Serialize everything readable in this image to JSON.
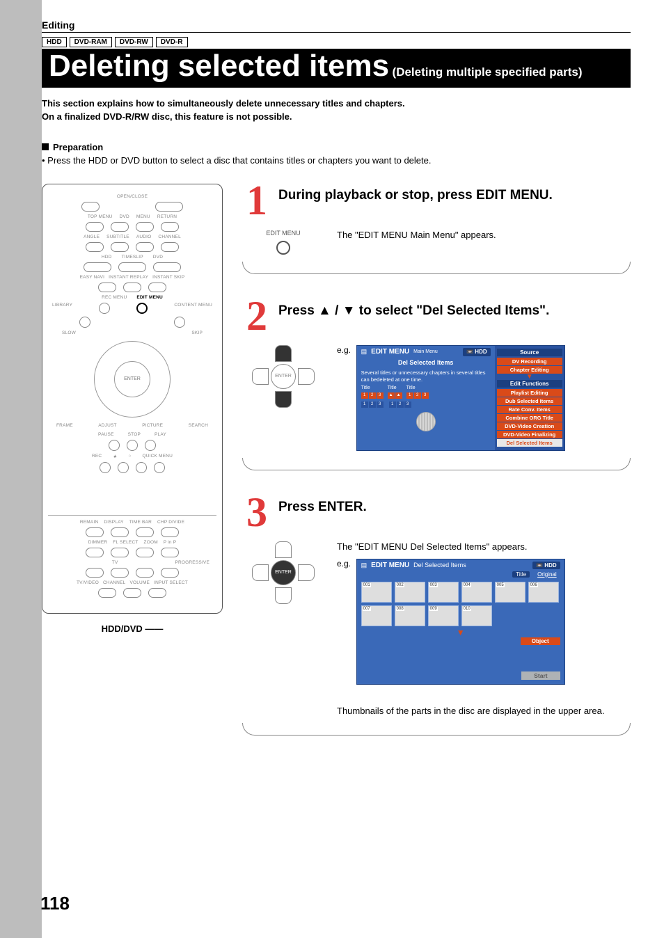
{
  "section": "Editing",
  "badges": [
    "HDD",
    "DVD-RAM",
    "DVD-RW",
    "DVD-R"
  ],
  "title_main": "Deleting selected items",
  "title_sub": "(Deleting multiple specified parts)",
  "intro_line1": "This section explains how to simultaneously delete unnecessary titles and chapters.",
  "intro_line2": "On a finalized DVD-R/RW disc, this feature is not possible.",
  "prep_head": "Preparation",
  "prep_body": "• Press the HDD or DVD button to select a disc that contains titles or chapters you want to delete.",
  "remote": {
    "open_close": "OPEN/CLOSE",
    "dvd": "DVD",
    "top_menu": "TOP MENU",
    "menu": "MENU",
    "return": "RETURN",
    "angle": "ANGLE",
    "subtitle": "SUBTITLE",
    "audio": "AUDIO",
    "channel": "CHANNEL",
    "hdd": "HDD",
    "timeslip": "TIMESLIP",
    "dvd2": "DVD",
    "instant_replay": "INSTANT REPLAY",
    "instant_skip": "INSTANT SKIP",
    "easy_navi": "EASY NAVI",
    "rec_menu": "REC MENU",
    "edit_menu": "EDIT MENU",
    "library": "LIBRARY",
    "content_menu": "CONTENT MENU",
    "slow": "SLOW",
    "skip": "SKIP",
    "enter": "ENTER",
    "frame": "FRAME",
    "adjust": "ADJUST",
    "picture": "PICTURE",
    "search": "SEARCH",
    "pause": "PAUSE",
    "stop": "STOP",
    "play": "PLAY",
    "rec": "REC",
    "quick_menu": "QUICK MENU",
    "remain": "REMAIN",
    "display": "DISPLAY",
    "time_bar": "TIME BAR",
    "chp_divide": "CHP DIVIDE",
    "dimmer": "DIMMER",
    "fl_select": "FL SELECT",
    "zoom": "ZOOM",
    "pinp": "P in P",
    "tv": "TV",
    "progressive": "PROGRESSIVE",
    "tvvideo": "TV/VIDEO",
    "channel2": "CHANNEL",
    "volume": "VOLUME",
    "input_select": "INPUT SELECT",
    "footer": "HDD/DVD"
  },
  "steps": {
    "s1": {
      "num": "1",
      "title": "During playback or stop, press EDIT MENU.",
      "aux_label": "EDIT MENU",
      "desc": "The \"EDIT MENU Main Menu\" appears."
    },
    "s2": {
      "num": "2",
      "title": "Press ▲ / ▼ to select \"Del Selected Items\".",
      "eg": "e.g.",
      "enter": "ENTER",
      "osd": {
        "brand": "EDIT MENU",
        "main": "Main Menu",
        "hdd": "HDD",
        "dsi": "Del Selected Items",
        "blurb": "Several titles or unnecessary chapters in several titles can bedeleted at one time.",
        "title_word": "Title",
        "source": "Source",
        "menu": [
          "DV Recording",
          "Chapter Editing"
        ],
        "edit_functions": "Edit Functions",
        "menu2": [
          "Playlist Editing",
          "Dub Selected Items",
          "Rate Conv. Items",
          "Combine ORG Title",
          "DVD-Video Creation",
          "DVD-Video Finalizing",
          "Del Selected Items"
        ]
      }
    },
    "s3": {
      "num": "3",
      "title": "Press ENTER.",
      "eg": "e.g.",
      "enter": "ENTER",
      "desc1": "The \"EDIT MENU Del Selected Items\" appears.",
      "desc2": "Thumbnails of the parts in the disc are displayed in the upper area.",
      "osd": {
        "brand": "EDIT MENU",
        "header": "Del Selected Items",
        "hdd": "HDD",
        "title": "Title",
        "original": "Original",
        "object": "Object",
        "start": "Start",
        "thumbs": [
          "001",
          "002",
          "003",
          "004",
          "005",
          "006",
          "007",
          "008",
          "009",
          "010"
        ]
      }
    }
  },
  "page_number": "118"
}
